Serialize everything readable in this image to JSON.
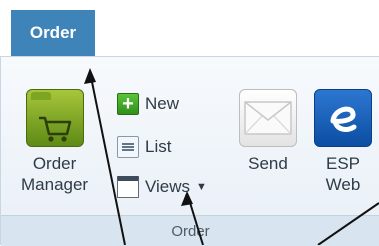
{
  "tab": {
    "label": "Order"
  },
  "ribbon": {
    "buttons": {
      "order_manager": {
        "line1": "Order",
        "line2": "Manager"
      },
      "new": {
        "label": "New"
      },
      "list": {
        "label": "List"
      },
      "views": {
        "label": "Views"
      },
      "send": {
        "label": "Send"
      },
      "esp_web": {
        "line1": "ESP",
        "line2": "Web"
      }
    },
    "group_label": "Order"
  },
  "colors": {
    "tab_bg": "#3f84b8",
    "ribbon_bg": "#eef3f8",
    "group_bar_bg": "#d8e4ef",
    "annotation_stroke": "#111111"
  },
  "icons": [
    "cart-folder-icon",
    "plus-icon",
    "list-icon",
    "views-icon",
    "envelope-icon",
    "esp-e-icon",
    "dropdown-caret-icon"
  ]
}
